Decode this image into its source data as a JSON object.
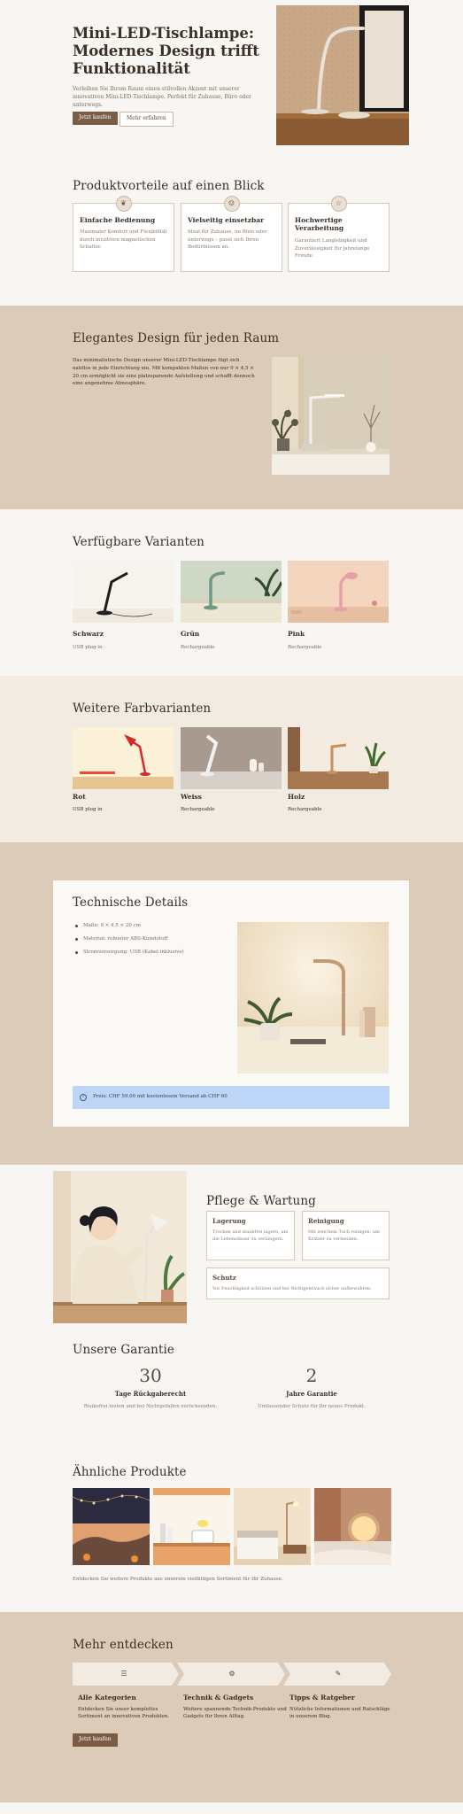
{
  "hero": {
    "title": "Mini-LED-Tischlampe: Modernes Design trifft Funktionalität",
    "lead": "Verleihen Sie Ihrem Raum einen stilvollen Akzent mit unserer innovativen Mini-LED-Tischlampe. Perfekt für Zuhause, Büro oder unterwegs.",
    "buy_label": "Jetzt kaufen",
    "more_label": "Mehr erfahren"
  },
  "features": {
    "title": "Produktvorteile auf einen Blick",
    "items": [
      {
        "icon": "leaf-icon",
        "title": "Einfache Bedienung",
        "text": "Maximaler Komfort und Flexibilität durch intuitiven magnetischen Schalter."
      },
      {
        "icon": "user-icon",
        "title": "Vielseitig einsetzbar",
        "text": "Ideal für Zuhause, im Büro oder unterwegs – passt sich Ihren Bedürfnissen an."
      },
      {
        "icon": "star-icon",
        "title": "Hochwertige Verarbeitung",
        "text": "Garantiert Langlebigkeit und Zuverlässigkeit für jahrelange Freude."
      }
    ]
  },
  "design": {
    "title": "Elegantes Design für jeden Raum",
    "text": "Das minimalistische Design unserer Mini-LED-Tischlampe fügt sich nahtlos in jede Einrichtung ein. Mit kompakten Maßen von nur 9 × 4,5 × 20 cm ermöglicht sie eine platzsparende Aufstellung und schafft dennoch eine angenehme Atmosphäre."
  },
  "variants": {
    "title": "Verfügbare Varianten",
    "items": [
      {
        "name": "Schwarz",
        "sub": "USB plug in"
      },
      {
        "name": "Grün",
        "sub": "Rechargeable"
      },
      {
        "name": "Pink",
        "sub": "Rechargeable"
      }
    ]
  },
  "variants2": {
    "title": "Weitere Farbvarianten",
    "items": [
      {
        "name": "Rot",
        "sub": "USB plug in"
      },
      {
        "name": "Weiss",
        "sub": "Rechargeable"
      },
      {
        "name": "Holz",
        "sub": "Rechargeable"
      }
    ]
  },
  "tech": {
    "title": "Technische Details",
    "specs": [
      "Maße: 9 × 4,5 × 20 cm",
      "Material: robuster ABS-Kunststoff",
      "Stromversorgung: USB (Kabel inklusive)"
    ],
    "note": "Preis: CHF 59.00 mit kostenlosem Versand ab CHF 60"
  },
  "care": {
    "title": "Pflege & Wartung",
    "boxes": [
      {
        "title": "Lagerung",
        "text": "Trocken und staubfrei lagern, um die Lebensdauer zu verlängern."
      },
      {
        "title": "Reinigung",
        "text": "Mit weichem Tuch reinigen, um Kratzer zu vermeiden."
      },
      {
        "title": "Schutz",
        "text": "Vor Feuchtigkeit schützen und bei Nichtgebrauch sicher aufbewahren."
      }
    ]
  },
  "guarantee": {
    "title": "Unsere Garantie",
    "items": [
      {
        "num": "30",
        "label": "Tage Rückgaberecht",
        "sub": "Risikofrei testen und bei Nichtgefallen zurücksenden."
      },
      {
        "num": "2",
        "label": "Jahre Garantie",
        "sub": "Umfassender Schutz für Ihr neues Produkt."
      }
    ]
  },
  "similar": {
    "title": "Ähnliche Produkte",
    "foot": "Entdecken Sie weitere Produkte aus unserem vielfältigen Sortiment für Ihr Zuhause."
  },
  "more": {
    "title": "Mehr entdecken",
    "items": [
      {
        "icon": "layers-icon",
        "title": "Alle Kategorien",
        "text": "Entdecken Sie unser komplettes Sortiment an innovativen Produkten."
      },
      {
        "icon": "gear-icon",
        "title": "Technik & Gadgets",
        "text": "Weitere spannende Technik-Produkte und Gadgets für Ihren Alltag."
      },
      {
        "icon": "bulb-icon",
        "title": "Tipps & Ratgeber",
        "text": "Nützliche Informationen und Ratschläge in unserem Blog."
      }
    ],
    "button_label": "Jetzt kaufen"
  },
  "colors": {
    "accent": "#7a5c45",
    "beige": "#dccbb8",
    "cream": "#f8f6f2",
    "info": "#bdd6f7"
  }
}
